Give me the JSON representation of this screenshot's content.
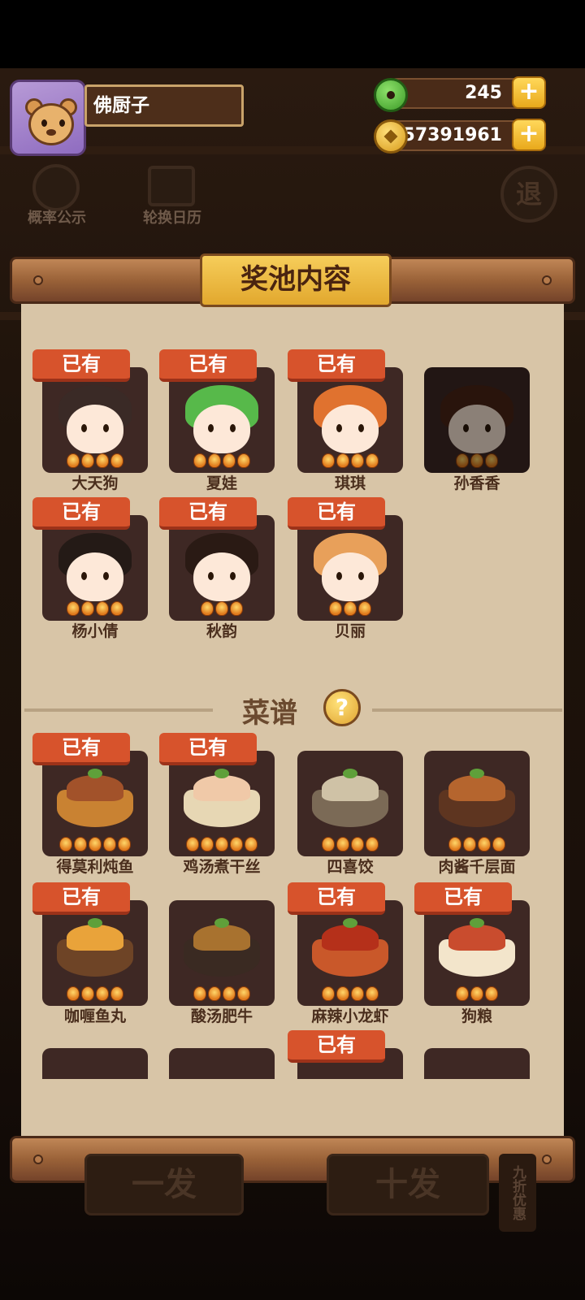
{
  "player": {
    "name": "佛厨子"
  },
  "resources": {
    "jade": "245",
    "coins": "57391961"
  },
  "background_labels": {
    "probability": "概率公示",
    "rotation": "轮换日历",
    "exit": "退",
    "one_draw": "一发",
    "ten_draw": "十发",
    "discount": "九折优惠"
  },
  "panel": {
    "title": "奖池内容",
    "owned_label": "已有",
    "recipes_title": "菜谱",
    "help": "?",
    "characters": [
      {
        "name": "大天狗",
        "owned": true,
        "stars": 4,
        "hair": "#3a2a26"
      },
      {
        "name": "夏娃",
        "owned": true,
        "stars": 4,
        "hair": "#57b94a"
      },
      {
        "name": "琪琪",
        "owned": true,
        "stars": 4,
        "hair": "#e0722f"
      },
      {
        "name": "孙香香",
        "owned": false,
        "stars": 3,
        "hair": "#4a2416"
      },
      {
        "name": "杨小倩",
        "owned": true,
        "stars": 4,
        "hair": "#241a16"
      },
      {
        "name": "秋韵",
        "owned": true,
        "stars": 3,
        "hair": "#2a1a14"
      },
      {
        "name": "贝丽",
        "owned": true,
        "stars": 3,
        "hair": "#e8a05a"
      }
    ],
    "recipes": [
      {
        "name": "得莫利炖鱼",
        "owned": true,
        "stars": 5,
        "bowl": "#c98232",
        "food": "#a2522a"
      },
      {
        "name": "鸡汤煮干丝",
        "owned": true,
        "stars": 5,
        "bowl": "#e7d7b4",
        "food": "#f0c9a8"
      },
      {
        "name": "四喜饺",
        "owned": false,
        "stars": 4,
        "bowl": "#7b6a56",
        "food": "#cfc2a6"
      },
      {
        "name": "肉酱千层面",
        "owned": false,
        "stars": 4,
        "bowl": "#5e3520",
        "food": "#b5652e"
      },
      {
        "name": "咖喱鱼丸",
        "owned": true,
        "stars": 4,
        "bowl": "#6e4426",
        "food": "#e9a33a"
      },
      {
        "name": "酸汤肥牛",
        "owned": false,
        "stars": 4,
        "bowl": "#3a2a22",
        "food": "#a8722f"
      },
      {
        "name": "麻辣小龙虾",
        "owned": true,
        "stars": 4,
        "bowl": "#c9582a",
        "food": "#b5301a"
      },
      {
        "name": "狗粮",
        "owned": true,
        "stars": 3,
        "bowl": "#f3e5cb",
        "food": "#c94c2e"
      }
    ],
    "partial_row": [
      {
        "owned": false
      },
      {
        "owned": false
      },
      {
        "owned": true
      },
      {
        "owned": false
      }
    ]
  }
}
